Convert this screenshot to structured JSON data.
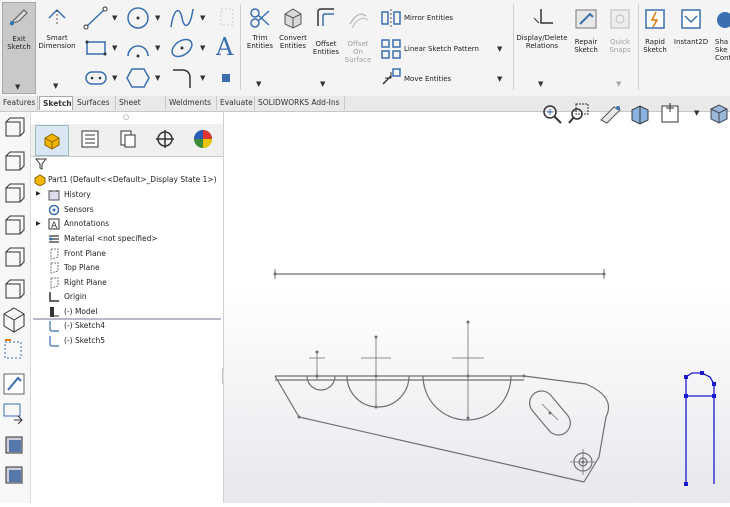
{
  "ribbon": {
    "exit_sketch": "Exit\nSketch",
    "smart_dimension": "Smart\nDimension",
    "trim_entities": "Trim\nEntities",
    "convert_entities": "Convert\nEntities",
    "offset_entities": "Offset\nEntities",
    "offset_on_surface": "Offset\nOn\nSurface",
    "mirror_entities": "Mirror Entities",
    "linear_sketch_pattern": "Linear Sketch Pattern",
    "move_entities": "Move Entities",
    "display_delete_relations": "Display/Delete\nRelations",
    "repair_sketch": "Repair\nSketch",
    "quick_snaps": "Quick\nSnaps",
    "rapid_sketch": "Rapid\nSketch",
    "instant2d": "Instant2D",
    "shaded_sketch_contours": "Sha\nSke\nCont",
    "text_glyph": "A"
  },
  "tabs": [
    "Features",
    "Sketch",
    "Surfaces",
    "Sheet Metal",
    "Weldments",
    "Evaluate",
    "SOLIDWORKS Add-Ins"
  ],
  "active_tab": "Sketch",
  "tree": {
    "part": "Part1  (Default<<Default>_Display State 1>)",
    "items": [
      "History",
      "Sensors",
      "Annotations",
      "Material <not specified>",
      "Front Plane",
      "Top Plane",
      "Right Plane",
      "Origin",
      "(-) Model",
      "(-) Sketch4",
      "(-) Sketch5"
    ]
  },
  "colors": {
    "sketch_line": "#707070",
    "selected_sketch": "#1a1acc",
    "ribbon_bg": "#f4f4f4"
  }
}
